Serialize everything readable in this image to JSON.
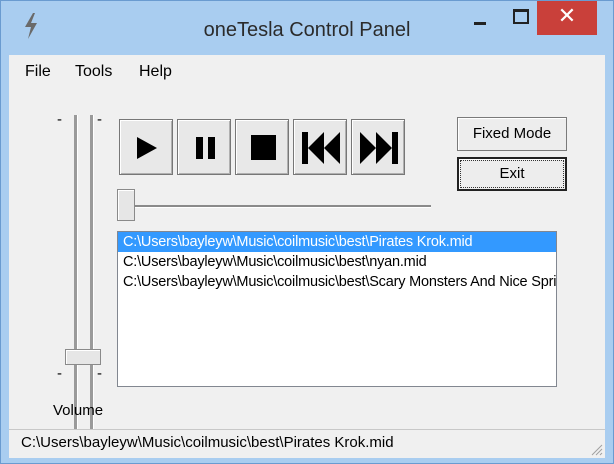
{
  "window": {
    "title": "oneTesla Control Panel",
    "close_glyph": "✕",
    "accent": "#a9cdf0",
    "close_color": "#c9403a"
  },
  "menu": {
    "items": [
      "File",
      "Tools",
      "Help"
    ]
  },
  "volume": {
    "label": "Volume",
    "tick": "-",
    "level": 0.2
  },
  "transport": {
    "icons": [
      "play-icon",
      "pause-icon",
      "stop-icon",
      "skip-back-icon",
      "skip-forward-icon"
    ]
  },
  "side_buttons": {
    "fixed_mode": "Fixed Mode",
    "exit": "Exit"
  },
  "seek": {
    "position": 0.0
  },
  "playlist": {
    "items": [
      {
        "text": "C:\\Users\\bayleyw\\Music\\coilmusic\\best\\Pirates Krok.mid",
        "selected": true
      },
      {
        "text": "C:\\Users\\bayleyw\\Music\\coilmusic\\best\\nyan.mid",
        "selected": false
      },
      {
        "text": "C:\\Users\\bayleyw\\Music\\coilmusic\\best\\Scary Monsters And Nice Sprites.mid",
        "selected": false
      }
    ],
    "selection_color": "#3399ff"
  },
  "status": {
    "text": "C:\\Users\\bayleyw\\Music\\coilmusic\\best\\Pirates Krok.mid"
  }
}
